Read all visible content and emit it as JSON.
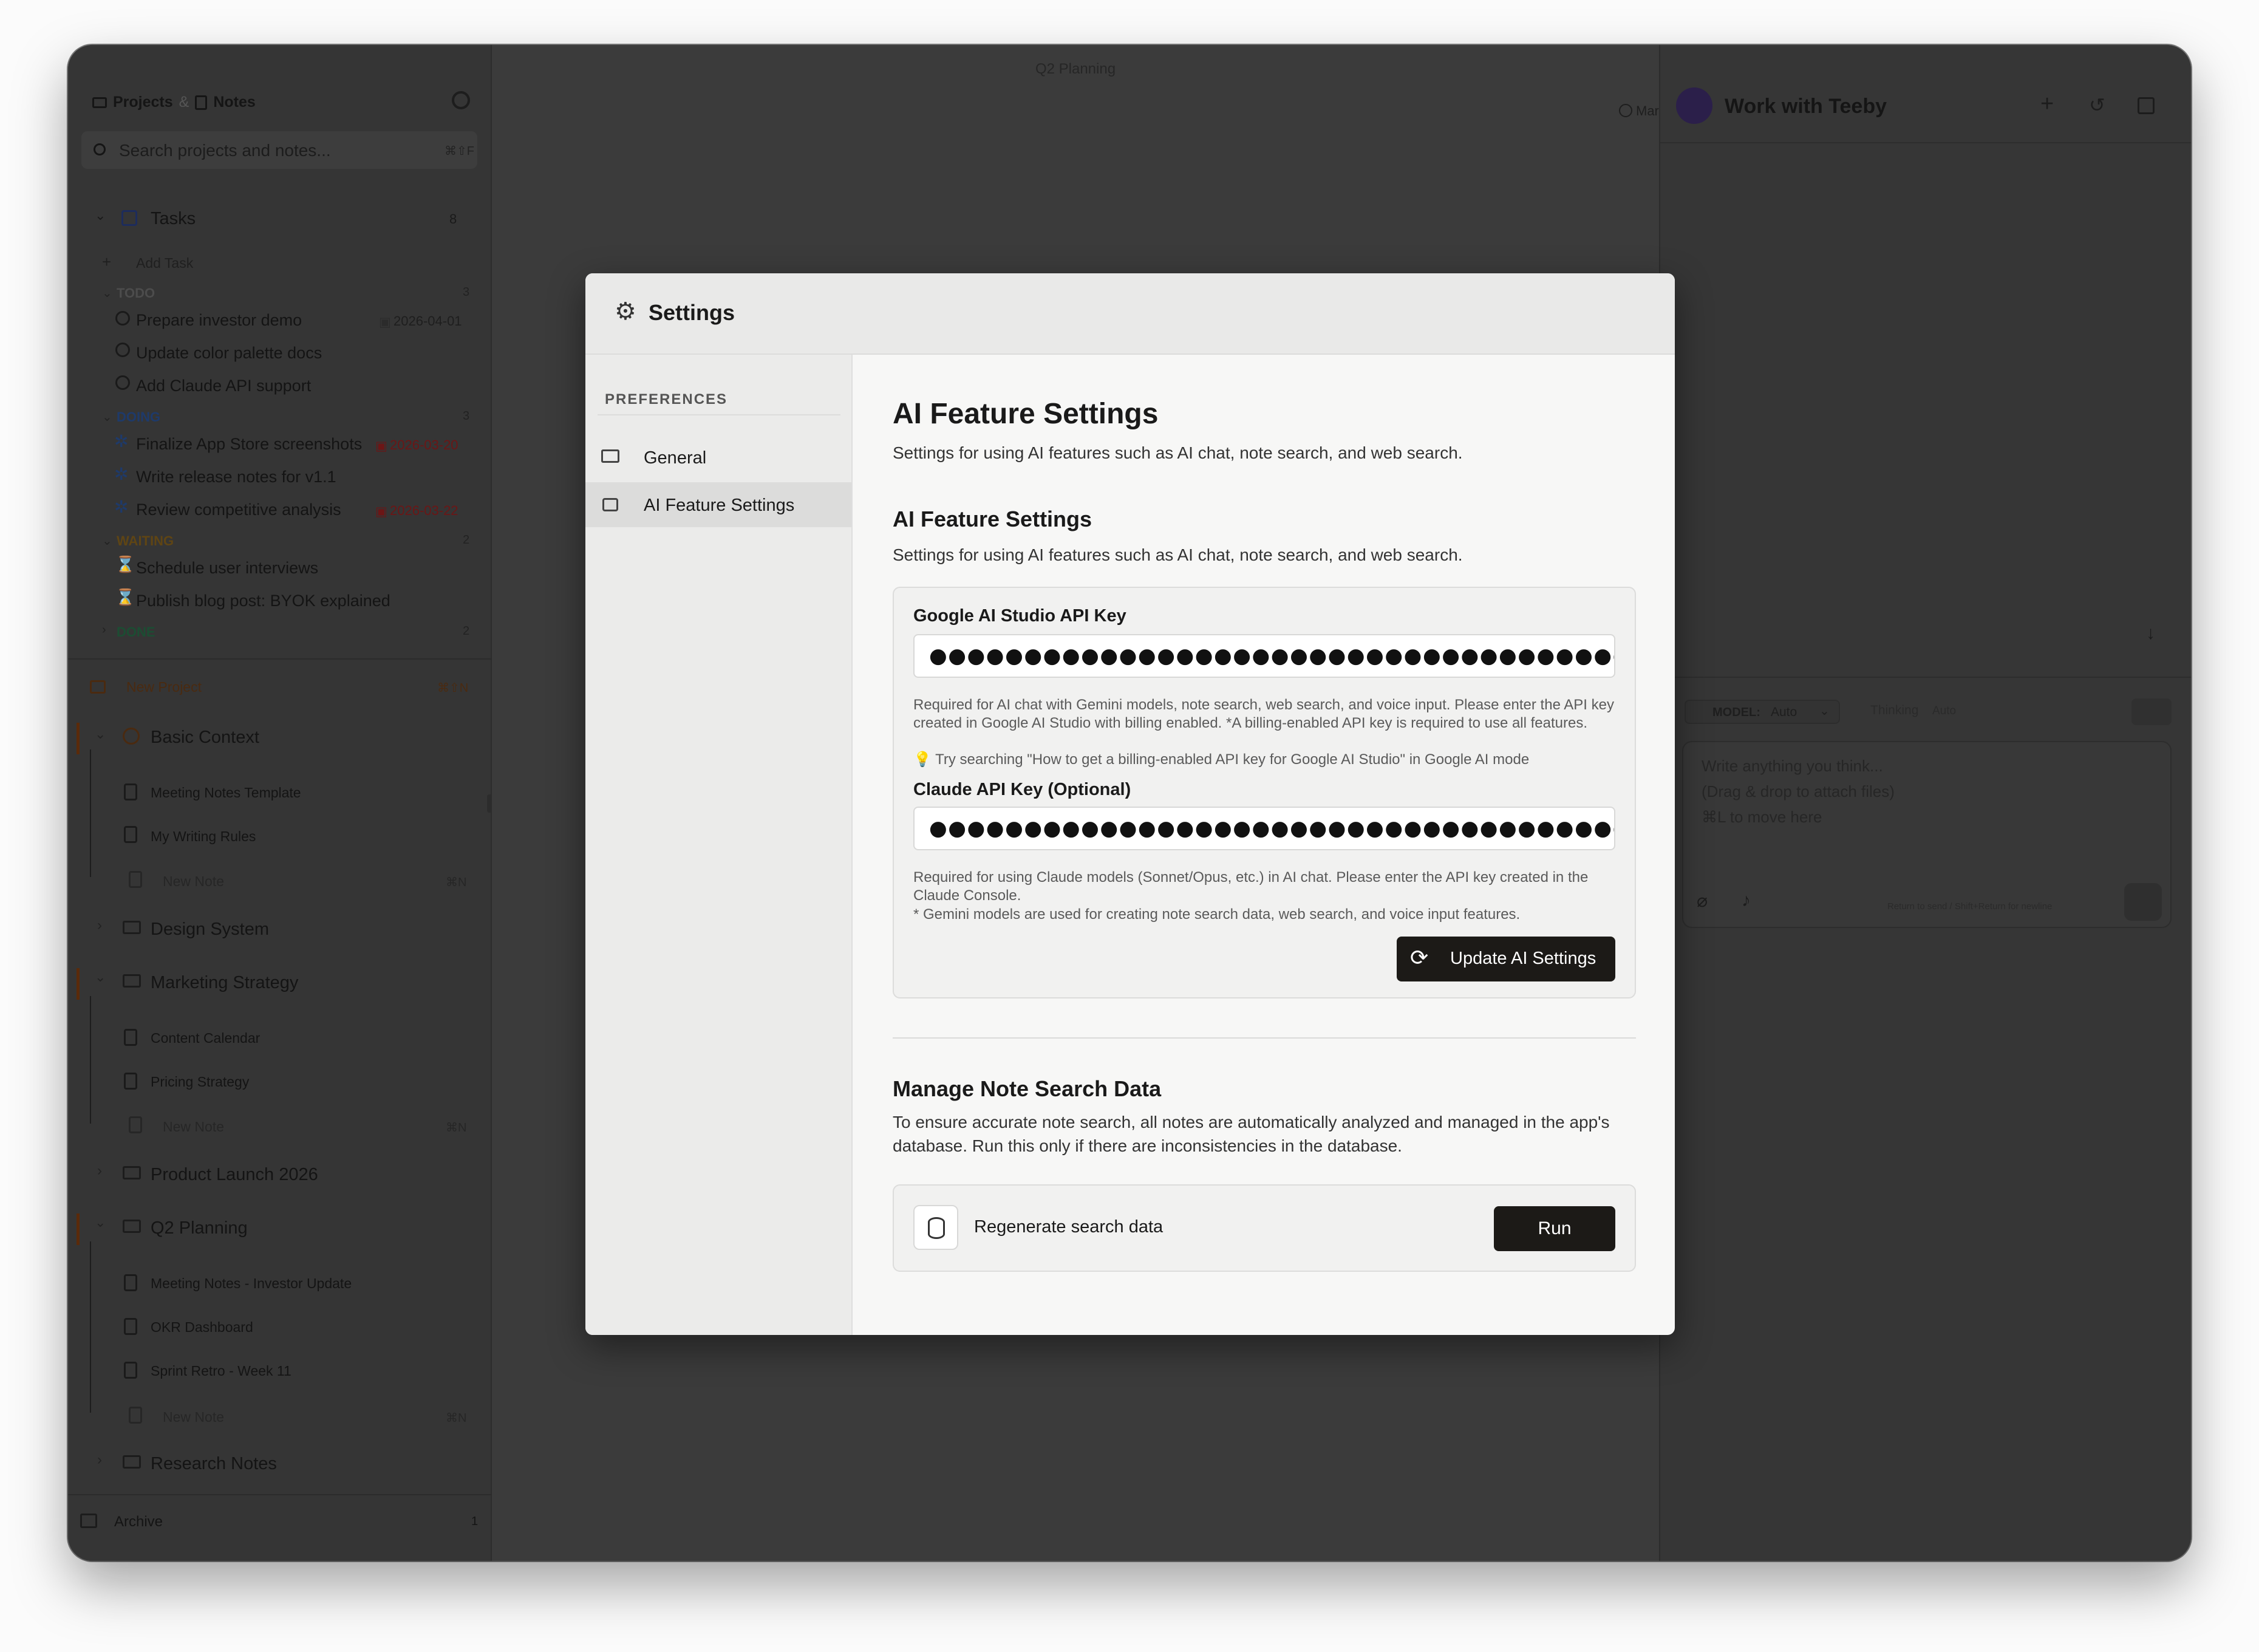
{
  "window": {
    "title": "Q2 Planning"
  },
  "sidebar": {
    "header": {
      "projects": "Projects",
      "amp": "&",
      "notes": "Notes"
    },
    "search": {
      "placeholder": "Search projects and notes...",
      "shortcut": "⌘⇧F"
    },
    "tasks": {
      "title": "Tasks",
      "count": "8",
      "add": "Add Task",
      "groups": [
        {
          "name": "TODO",
          "count": "3",
          "color": "#6b6b6b",
          "items": [
            {
              "label": "Prepare investor demo",
              "date": "2026-04-01",
              "date_color": "#6a6a6a"
            },
            {
              "label": "Update color palette docs",
              "date": ""
            },
            {
              "label": "Add Claude API support",
              "date": ""
            }
          ]
        },
        {
          "name": "DOING",
          "count": "3",
          "color": "#1e3a6a",
          "items": [
            {
              "label": "Finalize App Store screenshots",
              "date": "2026-03-20",
              "date_color": "#7a1818"
            },
            {
              "label": "Write release notes for v1.1",
              "date": ""
            },
            {
              "label": "Review competitive analysis",
              "date": "2026-03-22",
              "date_color": "#7a1818"
            }
          ]
        },
        {
          "name": "WAITING",
          "count": "2",
          "color": "#5f4514",
          "items": [
            {
              "label": "Schedule user interviews",
              "date": ""
            },
            {
              "label": "Publish blog post: BYOK explained",
              "date": ""
            }
          ]
        },
        {
          "name": "DONE",
          "count": "2",
          "color": "#1c4d33",
          "items": []
        }
      ]
    },
    "new_project": {
      "label": "New Project",
      "shortcut": "⌘⇧N"
    },
    "projects": [
      {
        "name": "Basic Context",
        "expanded": true,
        "notes": [
          "Meeting Notes Template",
          "My Writing Rules"
        ],
        "new_note": "New Note",
        "new_note_shortcut": "⌘N"
      },
      {
        "name": "Design System",
        "expanded": false
      },
      {
        "name": "Marketing Strategy",
        "expanded": true,
        "notes": [
          "Content Calendar",
          "Pricing Strategy"
        ],
        "new_note": "New Note",
        "new_note_shortcut": "⌘N"
      },
      {
        "name": "Product Launch 2026",
        "expanded": false
      },
      {
        "name": "Q2 Planning",
        "expanded": true,
        "notes": [
          "Meeting Notes - Investor Update",
          "OKR Dashboard",
          "Sprint Retro - Week 11"
        ],
        "new_note": "New Note",
        "new_note_shortcut": "⌘N"
      },
      {
        "name": "Research Notes",
        "expanded": false
      }
    ],
    "archive": {
      "label": "Archive",
      "count": "1"
    }
  },
  "editor": {
    "markdown_label": "Markdown"
  },
  "assistant": {
    "title": "Work with Teeby",
    "model_label": "MODEL:",
    "model_value": "Auto",
    "thinking_label": "Thinking",
    "thinking_value": "Auto",
    "input_placeholder_1": "Write anything you think...",
    "input_placeholder_2": "(Drag & drop to attach files)",
    "input_placeholder_3": "⌘L to move here",
    "send_hint": "Return to send / Shift+Return for newline"
  },
  "settings": {
    "title": "Settings",
    "nav_section": "PREFERENCES",
    "nav_items": [
      {
        "label": "General",
        "icon": "monitor-icon",
        "active": false
      },
      {
        "label": "AI Feature Settings",
        "icon": "robot-icon",
        "active": true
      }
    ],
    "page_title": "AI Feature Settings",
    "page_desc": "Settings for using AI features such as AI chat, note search, and web search.",
    "section_title": "AI Feature Settings",
    "section_desc": "Settings for using AI features such as AI chat, note search, and web search.",
    "google_key": {
      "label": "Google AI Studio API Key",
      "value": "●●●●●●●●●●●●●●●●●●●●●●●●●●●●●●●●●●●●●●●",
      "help": "Required for AI chat with Gemini models, note search, web search, and voice input. Please enter the API key created in Google AI Studio with billing enabled. *A billing-enabled API key is required to use all features.",
      "tip": "Try searching \"How to get a billing-enabled API key for Google AI Studio\" in Google AI mode"
    },
    "claude_key": {
      "label": "Claude API Key (Optional)",
      "value": "●●●●●●●●●●●●●●●●●●●●●●●●●●●●●●●●●●●●●●●●●●●●●●●●●●",
      "help": "Required for using Claude models (Sonnet/Opus, etc.) in AI chat. Please enter the API key created in the Claude Console.",
      "note": "* Gemini models are used for creating note search data, web search, and voice input features."
    },
    "update_button": "Update AI Settings",
    "manage_title": "Manage Note Search Data",
    "manage_desc": "To ensure accurate note search, all notes are automatically analyzed and managed in the app's database. Run this only if there are inconsistencies in the database.",
    "regen_label": "Regenerate search data",
    "run_button": "Run"
  }
}
